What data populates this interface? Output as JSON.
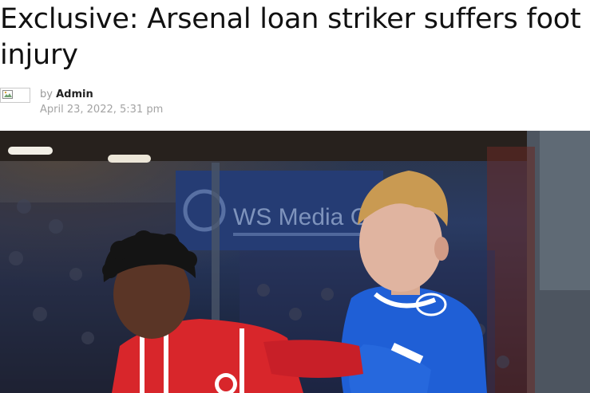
{
  "article": {
    "title": "Exclusive: Arsenal loan striker suffers foot injury",
    "byline_prefix": "by",
    "author": "Admin",
    "date": "April 23, 2022, 5:31 pm"
  },
  "hero_image": {
    "banner_text": "WS Media Gr",
    "colors": {
      "stadium_blue": "#1f3a73",
      "red_kit": "#d8262b",
      "blue_kit": "#1f5fd6",
      "hair_blond": "#c99a52",
      "hair_dark": "#141414"
    }
  },
  "icons": {
    "author_avatar": "broken-image-icon"
  }
}
